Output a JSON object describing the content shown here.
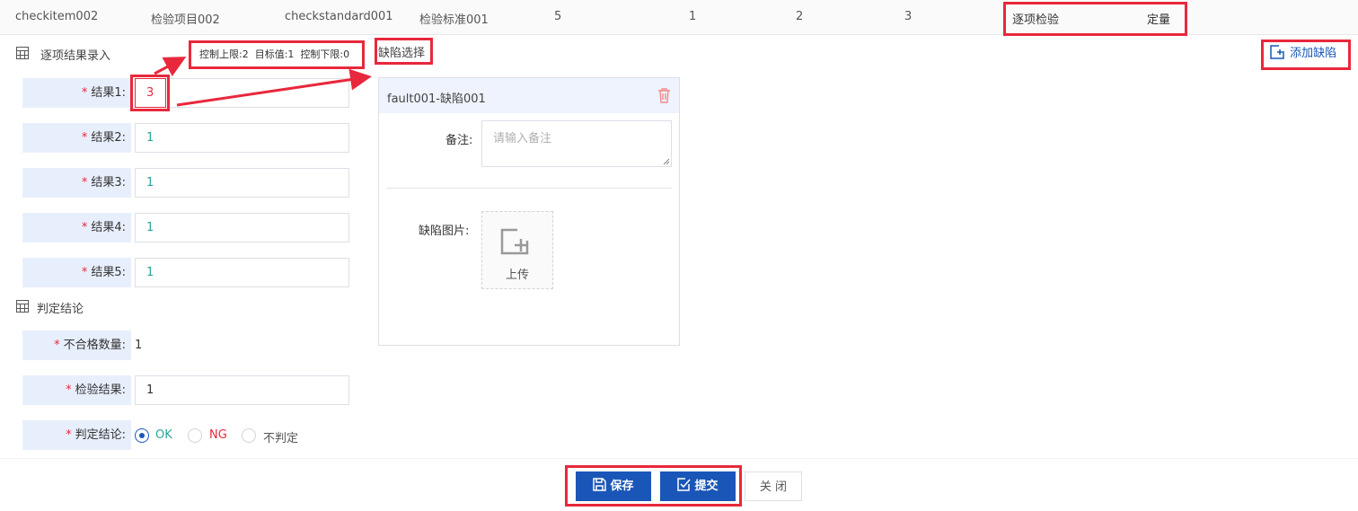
{
  "top_row": {
    "cells": [
      "checkitem002",
      "检验项目002",
      "checkstandard001",
      "检验标准001",
      "5",
      "1",
      "2",
      "3",
      "逐项检验",
      "定量"
    ]
  },
  "result_entry": {
    "title": "逐项结果录入",
    "limits": {
      "upper": "控制上限:2",
      "target": "目标值:1",
      "lower": "控制下限:0"
    },
    "fields": [
      {
        "label": "结果1:",
        "value": "3"
      },
      {
        "label": "结果2:",
        "value": "1"
      },
      {
        "label": "结果3:",
        "value": "1"
      },
      {
        "label": "结果4:",
        "value": "1"
      },
      {
        "label": "结果5:",
        "value": "1"
      }
    ],
    "required_mark": "*"
  },
  "defect": {
    "select_title": "缺陷选择",
    "add_button": "添加缺陷",
    "item_title": "fault001-缺陷001",
    "remark_label": "备注:",
    "remark_placeholder": "请输入备注",
    "image_label": "缺陷图片:",
    "upload_label": "上传"
  },
  "judgement": {
    "title": "判定结论",
    "unqualified_label": "不合格数量:",
    "unqualified_value": "1",
    "result_label": "检验结果:",
    "result_value": "1",
    "conclusion_label": "判定结论:",
    "options": [
      "OK",
      "NG",
      "不判定"
    ],
    "selected": "OK"
  },
  "footer": {
    "save": "保存",
    "submit": "提交",
    "close": "关 闭"
  },
  "colors": {
    "primary": "#1a56b8",
    "annotation_red": "#e8283c",
    "value_teal": "#27a59c",
    "label_bg": "#e8effc"
  }
}
